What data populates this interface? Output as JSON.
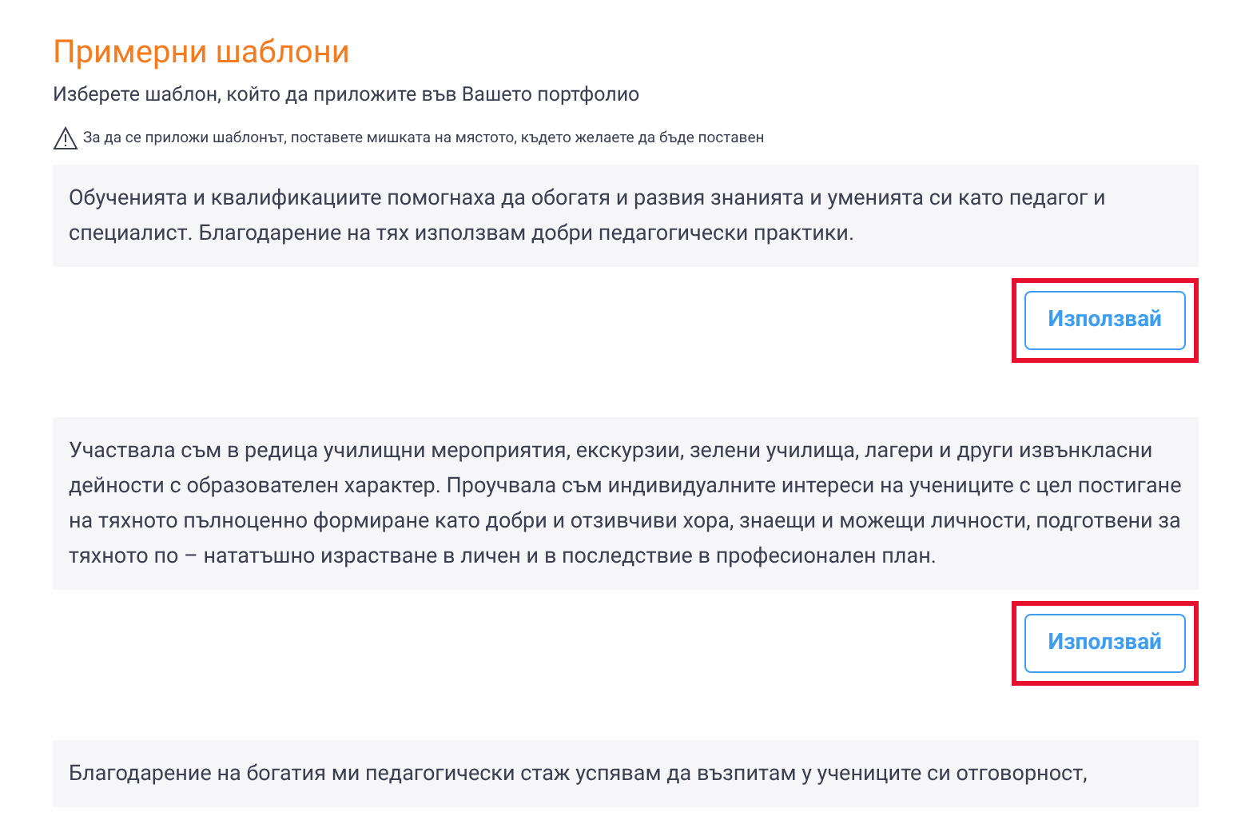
{
  "title": "Примерни шаблони",
  "subtitle": "Изберете шаблон, който да приложите във Вашето портфолио",
  "notice": "За да се приложи шаблонът, поставете мишката на мястото, където желаете да бъде поставен",
  "templates": [
    {
      "text": "Обученията и квалификациите помогнаха да обогатя и развия знанията и уменията си като педагог и специалист. Благодарение на тях използвам добри педагогически практики.",
      "button": "Използвай",
      "highlighted": true
    },
    {
      "text": "Участвала съм в редица училищни мероприятия, екскурзии, зелени училища, лагери и други извънкласни дейности с образователен характер. Проучвала съм индивидуалните интереси на учениците с цел постигане на тяхното пълноценно формиране като добри и отзивчиви хора, знаещи и можещи личности, подготвени за тяхното по – нататъшно израстване в личен и в последствие в професионален план.",
      "button": "Използвай",
      "highlighted": true
    },
    {
      "text": "Благодарение на богатия ми педагогически стаж успявам да възпитам у учениците си отговорност,"
    }
  ]
}
